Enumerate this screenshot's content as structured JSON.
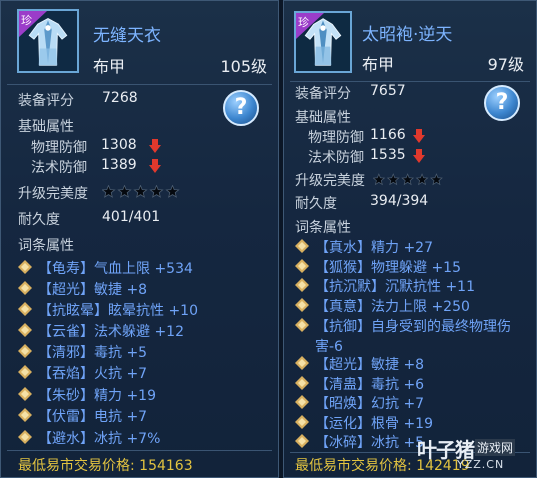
{
  "colors": {
    "item_name": "#7db4ff",
    "affix_text": "#6fa3f7",
    "price_text": "#e2c340",
    "rare_badge": "#9b3dc9",
    "down_arrow": "#e0392d",
    "affix_gem": "#d8b060"
  },
  "panels": [
    {
      "name": "无缝天衣",
      "rare_badge": "珍",
      "type": "布甲",
      "level": "105级",
      "score_label": "装备评分",
      "score_value": "7268",
      "base_attr_label": "基础属性",
      "stats": [
        {
          "label": "物理防御",
          "value": "1308",
          "trend": "down"
        },
        {
          "label": "法术防御",
          "value": "1389",
          "trend": "down"
        }
      ],
      "perfection_label": "升级完美度",
      "perfection_stars": 0,
      "perfection_max": 5,
      "durability_label": "耐久度",
      "durability_value": "401/401",
      "affix_label": "词条属性",
      "affixes": [
        "【龟寿】气血上限 +534",
        "【超光】敏捷 +8",
        "【抗眩晕】眩晕抗性 +10",
        "【云雀】法术躲避 +12",
        "【清邪】毒抗 +5",
        "【吞焰】火抗 +7",
        "【朱砂】精力 +19",
        "【伏雷】电抗 +7",
        "【避水】冰抗 +7%"
      ],
      "price_label": "最低易市交易价格: 154163",
      "help_icon": "help-question-icon"
    },
    {
      "name": "太昭袍·逆天",
      "rare_badge": "珍",
      "type": "布甲",
      "level": "97级",
      "score_label": "装备评分",
      "score_value": "7657",
      "base_attr_label": "基础属性",
      "stats": [
        {
          "label": "物理防御",
          "value": "1166",
          "trend": "down"
        },
        {
          "label": "法术防御",
          "value": "1535",
          "trend": "down"
        }
      ],
      "perfection_label": "升级完美度",
      "perfection_stars": 0,
      "perfection_max": 5,
      "durability_label": "耐久度",
      "durability_value": "394/394",
      "affix_label": "词条属性",
      "affixes": [
        "【真水】精力 +27",
        "【狐猴】物理躲避 +15",
        "【抗沉默】沉默抗性 +11",
        "【真意】法力上限 +250",
        "【抗御】自身受到的最终物理伤",
        "【超光】敏捷 +8",
        "【清蛊】毒抗 +6",
        "【昭焕】幻抗 +7",
        "【运化】根骨 +19",
        "【冰碎】冰抗 +5"
      ],
      "affix_continuation": "害-6",
      "price_label": "最低易市交易价格: 142419",
      "help_icon": "help-question-icon"
    }
  ],
  "watermark": {
    "main": "叶子猪",
    "sub": "游戏网",
    "url": "YZZ.CN"
  }
}
